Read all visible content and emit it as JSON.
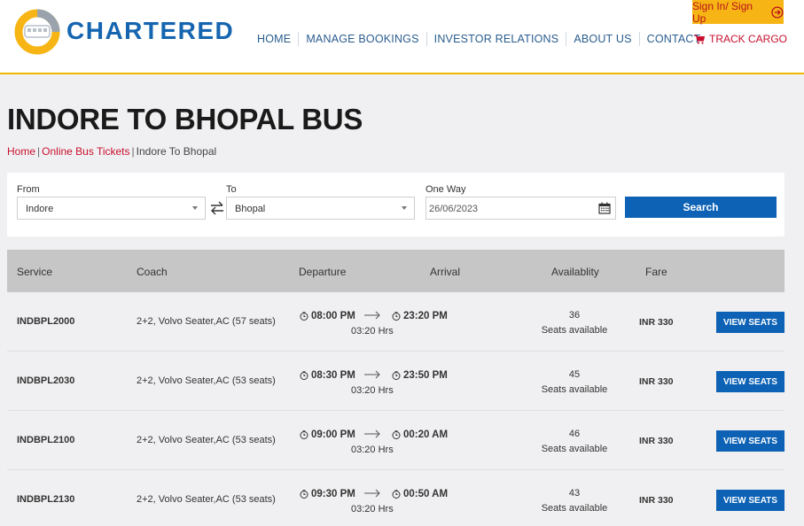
{
  "header": {
    "brand": "CHARTERED",
    "nav": [
      "HOME",
      "MANAGE BOOKINGS",
      "INVESTOR RELATIONS",
      "ABOUT US",
      "CONTACT"
    ],
    "signin_label": "Sign In/ Sign Up",
    "track_label": "TRACK CARGO",
    "colors": {
      "brand_blue": "#1565b0",
      "accent_yellow": "#f7b515",
      "accent_red": "#c8102e"
    }
  },
  "page": {
    "title": "INDORE TO BHOPAL BUS",
    "breadcrumb": [
      "Home",
      "Online Bus Tickets",
      "Indore To Bhopal"
    ]
  },
  "search": {
    "from_label": "From",
    "from_value": "Indore",
    "to_label": "To",
    "to_value": "Bhopal",
    "date_label": "One Way",
    "date_value": "26/06/2023",
    "button_label": "Search"
  },
  "table": {
    "headers": {
      "service": "Service",
      "coach": "Coach",
      "departure": "Departure",
      "arrival": "Arrival",
      "availability": "Availablity",
      "fare": "Fare"
    },
    "rows": [
      {
        "service": "INDBPL2000",
        "coach": "2+2, Volvo Seater,AC (57 seats)",
        "departure": "08:00 PM",
        "arrival": "23:20 PM",
        "duration": "03:20 Hrs",
        "seats": "36",
        "seats_label": "Seats available",
        "fare": "INR 330",
        "button": "VIEW SEATS"
      },
      {
        "service": "INDBPL2030",
        "coach": "2+2, Volvo Seater,AC (53 seats)",
        "departure": "08:30 PM",
        "arrival": "23:50 PM",
        "duration": "03:20 Hrs",
        "seats": "45",
        "seats_label": "Seats available",
        "fare": "INR 330",
        "button": "VIEW SEATS"
      },
      {
        "service": "INDBPL2100",
        "coach": "2+2, Volvo Seater,AC (53 seats)",
        "departure": "09:00 PM",
        "arrival": "00:20 AM",
        "duration": "03:20 Hrs",
        "seats": "46",
        "seats_label": "Seats available",
        "fare": "INR 330",
        "button": "VIEW SEATS"
      },
      {
        "service": "INDBPL2130",
        "coach": "2+2, Volvo Seater,AC (53 seats)",
        "departure": "09:30 PM",
        "arrival": "00:50 AM",
        "duration": "03:20 Hrs",
        "seats": "43",
        "seats_label": "Seats available",
        "fare": "INR 330",
        "button": "VIEW SEATS"
      }
    ]
  }
}
